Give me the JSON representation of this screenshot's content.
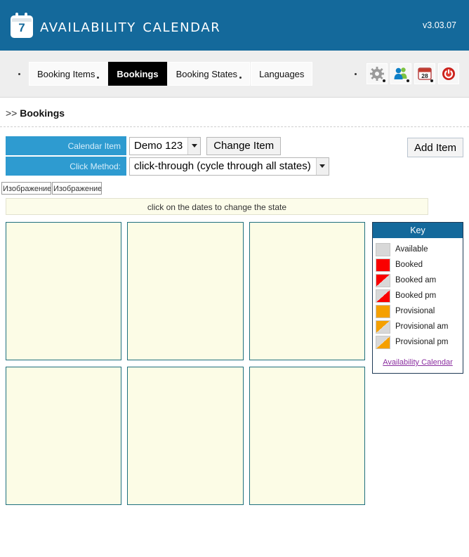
{
  "header": {
    "icon_name": "calendar-logo-icon",
    "icon_day": "7",
    "title": "Availability Calendar",
    "version": "v3.03.07",
    "bg_color": "#14699B"
  },
  "nav": {
    "tabs": [
      {
        "label": "Booking Items",
        "active": false,
        "has_dot": true
      },
      {
        "label": "Bookings",
        "active": true,
        "has_dot": false
      },
      {
        "label": "Booking States",
        "active": false,
        "has_dot": true
      },
      {
        "label": "Languages",
        "active": false,
        "has_dot": false
      }
    ],
    "icons": [
      {
        "name": "gear-icon",
        "title": "Settings"
      },
      {
        "name": "users-icon",
        "title": "Users"
      },
      {
        "name": "calendar-28-icon",
        "title": "Calendar",
        "day": "28"
      },
      {
        "name": "power-icon",
        "title": "Log out"
      }
    ]
  },
  "breadcrumb": {
    "chevron": ">>",
    "label": "Bookings"
  },
  "form": {
    "calendar_item": {
      "label": "Calendar Item",
      "value": "Demo 123",
      "change_button": "Change Item"
    },
    "click_method": {
      "label": "Click Method:",
      "value": "click-through (cycle through all states)"
    },
    "add_item_button": "Add Item"
  },
  "broken_images": [
    {
      "alt": "Изображение"
    },
    {
      "alt": "Изображение"
    }
  ],
  "instruction": "click on the dates to change the state",
  "calendar": {
    "box_count": 6,
    "empty_fill": "#fcfce6",
    "border_color": "#1e6f7d"
  },
  "key": {
    "title": "Key",
    "items": [
      {
        "label": "Available",
        "style": "full",
        "color": "#d8d8d8"
      },
      {
        "label": "Booked",
        "style": "full",
        "color": "#FA0000"
      },
      {
        "label": "Booked am",
        "style": "am",
        "color": "#FA0000",
        "base": "#d8d8d8"
      },
      {
        "label": "Booked pm",
        "style": "pm",
        "color": "#FA0000",
        "base": "#d8d8d8"
      },
      {
        "label": "Provisional",
        "style": "full",
        "color": "#F5A000"
      },
      {
        "label": "Provisional am",
        "style": "am",
        "color": "#F5A000",
        "base": "#d8d8d8"
      },
      {
        "label": "Provisional pm",
        "style": "pm",
        "color": "#F5A000",
        "base": "#d8d8d8"
      }
    ],
    "link": "Availability Calendar",
    "link_color": "#8b2fa0"
  }
}
